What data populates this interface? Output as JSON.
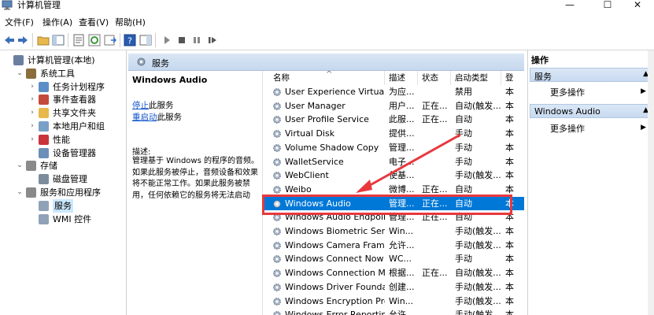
{
  "window": {
    "title": "计算机管理",
    "controls": [
      "—",
      "☐",
      "✕"
    ]
  },
  "menu": [
    "文件(F)",
    "操作(A)",
    "查看(V)",
    "帮助(H)"
  ],
  "tree": [
    {
      "label": "计算机管理(本地)",
      "indent": 0,
      "exp": "",
      "icon": "computer-icon",
      "color": "#6a7fa0"
    },
    {
      "label": "系统工具",
      "indent": 1,
      "exp": "⌄",
      "icon": "tools-icon",
      "color": "#8a6d3b"
    },
    {
      "label": "任务计划程序",
      "indent": 2,
      "exp": "›",
      "icon": "clock-icon",
      "color": "#5c8fc8"
    },
    {
      "label": "事件查看器",
      "indent": 2,
      "exp": "›",
      "icon": "event-icon",
      "color": "#c44b3b"
    },
    {
      "label": "共享文件夹",
      "indent": 2,
      "exp": "›",
      "icon": "folder-icon",
      "color": "#e7b84a"
    },
    {
      "label": "本地用户和组",
      "indent": 2,
      "exp": "›",
      "icon": "users-icon",
      "color": "#7aa0c8"
    },
    {
      "label": "性能",
      "indent": 2,
      "exp": "›",
      "icon": "performance-icon",
      "color": "#c9343a"
    },
    {
      "label": "设备管理器",
      "indent": 2,
      "exp": "",
      "icon": "device-icon",
      "color": "#6b8fb8"
    },
    {
      "label": "存储",
      "indent": 1,
      "exp": "⌄",
      "icon": "storage-icon",
      "color": "#8a8a8a"
    },
    {
      "label": "磁盘管理",
      "indent": 2,
      "exp": "",
      "icon": "disk-icon",
      "color": "#7c8c9c"
    },
    {
      "label": "服务和应用程序",
      "indent": 1,
      "exp": "⌄",
      "icon": "apps-icon",
      "color": "#8a8a8a"
    },
    {
      "label": "服务",
      "indent": 2,
      "exp": "",
      "icon": "services-icon",
      "color": "#8fa2b8",
      "selected": true
    },
    {
      "label": "WMI 控件",
      "indent": 2,
      "exp": "",
      "icon": "wmi-icon",
      "color": "#8fa2b8"
    }
  ],
  "center": {
    "header": "服务",
    "selected_service": "Windows Audio",
    "stop_link": "停止",
    "stop_suffix": "此服务",
    "restart_link": "重启动",
    "restart_suffix": "此服务",
    "desc_label": "描述:",
    "desc_lines": [
      "管理基于 Windows 的程序的音频。",
      "如果此服务被停止，音频设备和效果",
      "将不能正常工作。如果此服务被禁",
      "用，任何依赖它的服务将无法启动"
    ]
  },
  "columns": [
    "名称",
    "描述",
    "状态",
    "启动类型",
    "登"
  ],
  "services": [
    {
      "name": "User Experience Virtualiz...",
      "desc": "为应...",
      "status": "",
      "startup": "禁用",
      "logon": "本"
    },
    {
      "name": "User Manager",
      "desc": "用户...",
      "status": "正在...",
      "startup": "自动(触发...",
      "logon": "本"
    },
    {
      "name": "User Profile Service",
      "desc": "此服...",
      "status": "正在...",
      "startup": "自动",
      "logon": "本"
    },
    {
      "name": "Virtual Disk",
      "desc": "提供...",
      "status": "",
      "startup": "手动",
      "logon": "本"
    },
    {
      "name": "Volume Shadow Copy",
      "desc": "管理...",
      "status": "",
      "startup": "手动",
      "logon": "本"
    },
    {
      "name": "WalletService",
      "desc": "电子...",
      "status": "",
      "startup": "手动",
      "logon": "本"
    },
    {
      "name": "WebClient",
      "desc": "使基...",
      "status": "",
      "startup": "手动(触发...",
      "logon": "本"
    },
    {
      "name": "Weibo",
      "desc": "微博...",
      "status": "正在...",
      "startup": "自动",
      "logon": "本"
    },
    {
      "name": "Windows Audio",
      "desc": "管理...",
      "status": "正在...",
      "startup": "自动",
      "logon": "本",
      "highlight": true
    },
    {
      "name": "Windows Audio Endpoint...",
      "desc": "管理...",
      "status": "正在...",
      "startup": "自动",
      "logon": "本"
    },
    {
      "name": "Windows Biometric Servi...",
      "desc": "Win...",
      "status": "",
      "startup": "手动(触发...",
      "logon": "本"
    },
    {
      "name": "Windows Camera Frame ...",
      "desc": "允许...",
      "status": "",
      "startup": "手动(触发...",
      "logon": "本"
    },
    {
      "name": "Windows Connect Now -...",
      "desc": "WC...",
      "status": "",
      "startup": "手动",
      "logon": "本"
    },
    {
      "name": "Windows Connection Ma...",
      "desc": "根据...",
      "status": "正在...",
      "startup": "自动(触发...",
      "logon": "本"
    },
    {
      "name": "Windows Driver Foundati...",
      "desc": "创建...",
      "status": "",
      "startup": "手动(触发...",
      "logon": "本"
    },
    {
      "name": "Windows Encryption Pro...",
      "desc": "Win...",
      "status": "",
      "startup": "手动(触发...",
      "logon": "本"
    },
    {
      "name": "Windows Error Reportin...",
      "desc": "允许...",
      "status": "",
      "startup": "手动(触发...",
      "logon": "本"
    }
  ],
  "actions": {
    "header": "操作",
    "group1": "服务",
    "more1": "更多操作",
    "group2": "Windows Audio",
    "more2": "更多操作"
  },
  "colors": {
    "highlight": "#0078d7",
    "annotation": "#e8383d",
    "link": "#1155cc"
  }
}
